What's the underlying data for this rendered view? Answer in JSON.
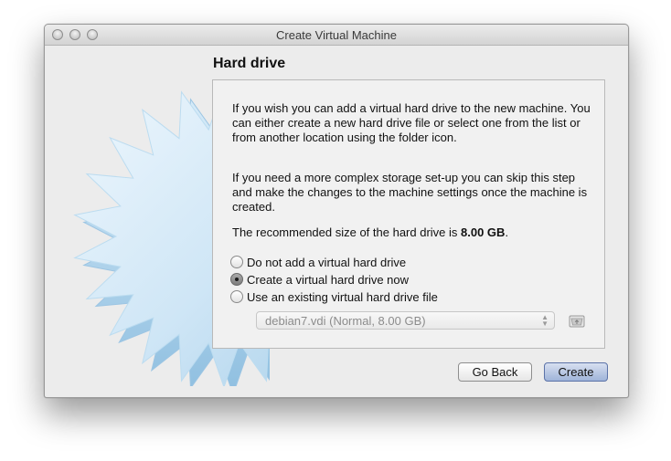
{
  "window": {
    "title": "Create Virtual Machine"
  },
  "page": {
    "heading": "Hard drive"
  },
  "panel": {
    "paragraph_1": "If you wish you can add a virtual hard drive to the new machine. You can either create a new hard drive file or select one from the list or from another location using the folder icon.",
    "paragraph_2": "If you need a more complex storage set-up you can skip this step and make the changes to the machine settings once the machine is created.",
    "recommended_prefix": "The recommended size of the hard drive is ",
    "recommended_size": "8.00 GB",
    "recommended_suffix": "."
  },
  "options": [
    {
      "label": "Do not add a virtual hard drive",
      "selected": false
    },
    {
      "label": "Create a virtual hard drive now",
      "selected": true
    },
    {
      "label": "Use an existing virtual hard drive file",
      "selected": false
    }
  ],
  "disk_select": {
    "value": "debian7.vdi (Normal, 8.00 GB)",
    "enabled": false
  },
  "buttons": {
    "back": "Go Back",
    "create": "Create"
  },
  "icons": {
    "folder": "folder-icon",
    "dropdown": "updown-arrows-icon"
  },
  "colors": {
    "default_button": "#9fb4d9",
    "starburst": "#cfe6f6"
  }
}
